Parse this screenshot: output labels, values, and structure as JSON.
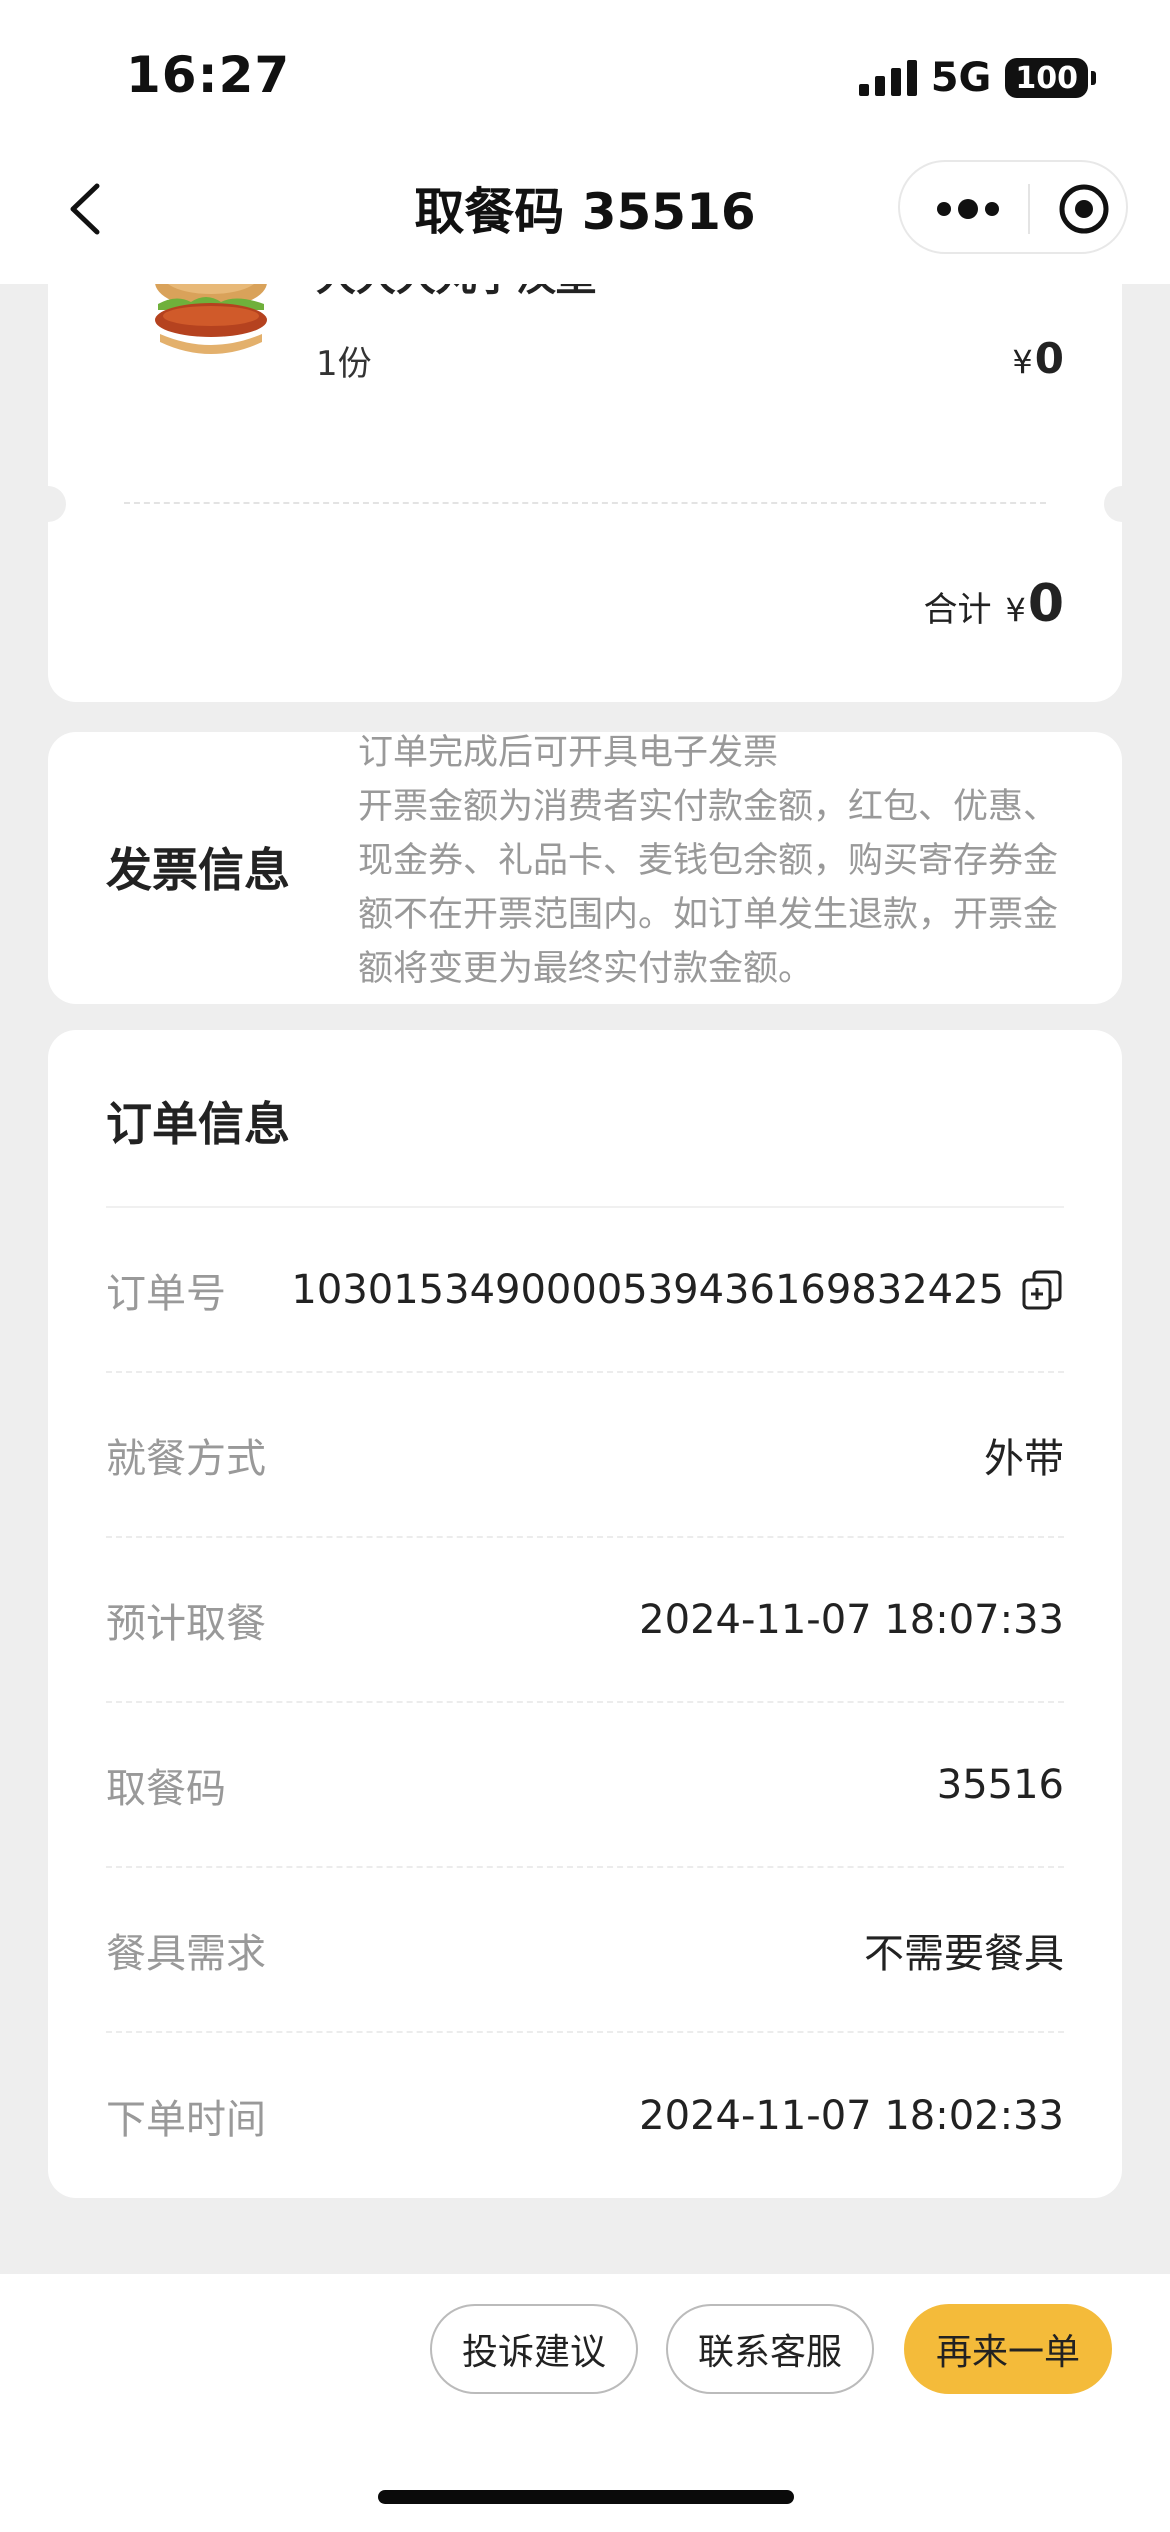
{
  "status_bar": {
    "time": "16:27",
    "network": "5G",
    "battery": "100"
  },
  "nav": {
    "title": "取餐码 35516"
  },
  "product": {
    "name": "大大大丸子汉堡",
    "qty": "1份",
    "price_symbol": "¥",
    "price_value": "0"
  },
  "total": {
    "label": "合计",
    "symbol": "¥",
    "value": "0"
  },
  "invoice": {
    "title": "发票信息",
    "text": "订单完成后可开具电子发票\n开票金额为消费者实付款金额，红包、优惠、现金券、礼品卡、麦钱包余额，购买寄存券金额不在开票范围内。如订单发生退款，开票金额将变更为最终实付款金额。"
  },
  "order": {
    "title": "订单信息",
    "rows": [
      {
        "label": "订单号",
        "value": "1030153490000539436169832425"
      },
      {
        "label": "就餐方式",
        "value": "外带"
      },
      {
        "label": "预计取餐",
        "value": "2024-11-07 18:07:33"
      },
      {
        "label": "取餐码",
        "value": "35516"
      },
      {
        "label": "餐具需求",
        "value": "不需要餐具"
      },
      {
        "label": "下单时间",
        "value": "2024-11-07 18:02:33"
      }
    ]
  },
  "actions": {
    "complain": "投诉建议",
    "service": "联系客服",
    "reorder": "再来一单"
  },
  "colors": {
    "accent": "#f4bb3a",
    "background": "#eeeeee"
  }
}
